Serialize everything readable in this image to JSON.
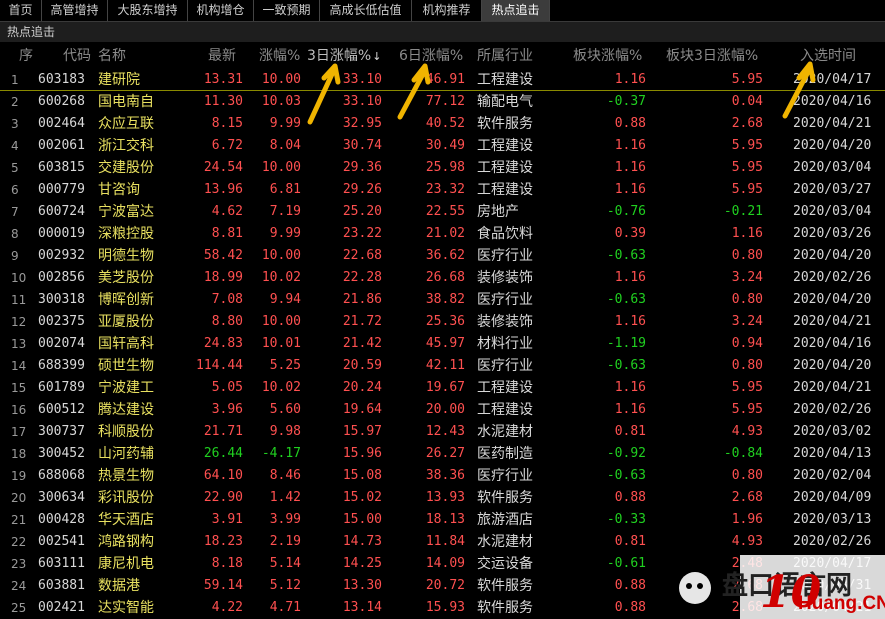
{
  "tabs": [
    {
      "label": "首页",
      "active": false
    },
    {
      "label": "高管增持",
      "active": false
    },
    {
      "label": "大股东增持",
      "active": false
    },
    {
      "label": "机构增仓",
      "active": false
    },
    {
      "label": "一致预期",
      "active": false
    },
    {
      "label": "高成长低估值",
      "active": false
    },
    {
      "label": "机构推荐",
      "active": false
    },
    {
      "label": "热点追击",
      "active": true
    }
  ],
  "subtitle": "热点追击",
  "columns": {
    "idx": "序",
    "code": "代码",
    "name": "名称",
    "price": "最新",
    "chg": "涨幅%",
    "chg3": "3日涨幅%",
    "chg6": "6日涨幅%",
    "industry": "所属行业",
    "sector_chg": "板块涨幅%",
    "sector_chg3": "板块3日涨幅%",
    "date": "入选时间",
    "sort_arrow": "↓"
  },
  "rows": [
    {
      "idx": "1",
      "code": "603183",
      "name": "建研院",
      "price": "13.31",
      "chg": "10.00",
      "chg3": "33.10",
      "chg6": "46.91",
      "industry": "工程建设",
      "sector_chg": "1.16",
      "sector_chg3": "5.95",
      "date": "2020/04/17"
    },
    {
      "idx": "2",
      "code": "600268",
      "name": "国电南自",
      "price": "11.30",
      "chg": "10.03",
      "chg3": "33.10",
      "chg6": "77.12",
      "industry": "输配电气",
      "sector_chg": "-0.37",
      "sector_chg3": "0.04",
      "date": "2020/04/16"
    },
    {
      "idx": "3",
      "code": "002464",
      "name": "众应互联",
      "price": "8.15",
      "chg": "9.99",
      "chg3": "32.95",
      "chg6": "40.52",
      "industry": "软件服务",
      "sector_chg": "0.88",
      "sector_chg3": "2.68",
      "date": "2020/04/21"
    },
    {
      "idx": "4",
      "code": "002061",
      "name": "浙江交科",
      "price": "6.72",
      "chg": "8.04",
      "chg3": "30.74",
      "chg6": "30.49",
      "industry": "工程建设",
      "sector_chg": "1.16",
      "sector_chg3": "5.95",
      "date": "2020/04/20"
    },
    {
      "idx": "5",
      "code": "603815",
      "name": "交建股份",
      "price": "24.54",
      "chg": "10.00",
      "chg3": "29.36",
      "chg6": "25.98",
      "industry": "工程建设",
      "sector_chg": "1.16",
      "sector_chg3": "5.95",
      "date": "2020/03/04"
    },
    {
      "idx": "6",
      "code": "000779",
      "name": "甘咨询",
      "price": "13.96",
      "chg": "6.81",
      "chg3": "29.26",
      "chg6": "23.32",
      "industry": "工程建设",
      "sector_chg": "1.16",
      "sector_chg3": "5.95",
      "date": "2020/03/27"
    },
    {
      "idx": "7",
      "code": "600724",
      "name": "宁波富达",
      "price": "4.62",
      "chg": "7.19",
      "chg3": "25.20",
      "chg6": "22.55",
      "industry": "房地产",
      "sector_chg": "-0.76",
      "sector_chg3": "-0.21",
      "date": "2020/03/04"
    },
    {
      "idx": "8",
      "code": "000019",
      "name": "深粮控股",
      "price": "8.81",
      "chg": "9.99",
      "chg3": "23.22",
      "chg6": "21.02",
      "industry": "食品饮料",
      "sector_chg": "0.39",
      "sector_chg3": "1.16",
      "date": "2020/03/26"
    },
    {
      "idx": "9",
      "code": "002932",
      "name": "明德生物",
      "price": "58.42",
      "chg": "10.00",
      "chg3": "22.68",
      "chg6": "36.62",
      "industry": "医疗行业",
      "sector_chg": "-0.63",
      "sector_chg3": "0.80",
      "date": "2020/04/20"
    },
    {
      "idx": "10",
      "code": "002856",
      "name": "美芝股份",
      "price": "18.99",
      "chg": "10.02",
      "chg3": "22.28",
      "chg6": "26.68",
      "industry": "装修装饰",
      "sector_chg": "1.16",
      "sector_chg3": "3.24",
      "date": "2020/02/26"
    },
    {
      "idx": "11",
      "code": "300318",
      "name": "博晖创新",
      "price": "7.08",
      "chg": "9.94",
      "chg3": "21.86",
      "chg6": "38.82",
      "industry": "医疗行业",
      "sector_chg": "-0.63",
      "sector_chg3": "0.80",
      "date": "2020/04/20"
    },
    {
      "idx": "12",
      "code": "002375",
      "name": "亚厦股份",
      "price": "8.80",
      "chg": "10.00",
      "chg3": "21.72",
      "chg6": "25.36",
      "industry": "装修装饰",
      "sector_chg": "1.16",
      "sector_chg3": "3.24",
      "date": "2020/04/21"
    },
    {
      "idx": "13",
      "code": "002074",
      "name": "国轩高科",
      "price": "24.83",
      "chg": "10.01",
      "chg3": "21.42",
      "chg6": "45.97",
      "industry": "材料行业",
      "sector_chg": "-1.19",
      "sector_chg3": "0.94",
      "date": "2020/04/16"
    },
    {
      "idx": "14",
      "code": "688399",
      "name": "硕世生物",
      "price": "114.44",
      "chg": "5.25",
      "chg3": "20.59",
      "chg6": "42.11",
      "industry": "医疗行业",
      "sector_chg": "-0.63",
      "sector_chg3": "0.80",
      "date": "2020/04/20"
    },
    {
      "idx": "15",
      "code": "601789",
      "name": "宁波建工",
      "price": "5.05",
      "chg": "10.02",
      "chg3": "20.24",
      "chg6": "19.67",
      "industry": "工程建设",
      "sector_chg": "1.16",
      "sector_chg3": "5.95",
      "date": "2020/04/21"
    },
    {
      "idx": "16",
      "code": "600512",
      "name": "腾达建设",
      "price": "3.96",
      "chg": "5.60",
      "chg3": "19.64",
      "chg6": "20.00",
      "industry": "工程建设",
      "sector_chg": "1.16",
      "sector_chg3": "5.95",
      "date": "2020/02/26"
    },
    {
      "idx": "17",
      "code": "300737",
      "name": "科顺股份",
      "price": "21.71",
      "chg": "9.98",
      "chg3": "15.97",
      "chg6": "12.43",
      "industry": "水泥建材",
      "sector_chg": "0.81",
      "sector_chg3": "4.93",
      "date": "2020/03/02"
    },
    {
      "idx": "18",
      "code": "300452",
      "name": "山河药辅",
      "price": "26.44",
      "chg": "-4.17",
      "chg3": "15.96",
      "chg6": "26.27",
      "industry": "医药制造",
      "sector_chg": "-0.92",
      "sector_chg3": "-0.84",
      "date": "2020/04/13"
    },
    {
      "idx": "19",
      "code": "688068",
      "name": "热景生物",
      "price": "64.10",
      "chg": "8.46",
      "chg3": "15.08",
      "chg6": "38.36",
      "industry": "医疗行业",
      "sector_chg": "-0.63",
      "sector_chg3": "0.80",
      "date": "2020/02/04"
    },
    {
      "idx": "20",
      "code": "300634",
      "name": "彩讯股份",
      "price": "22.90",
      "chg": "1.42",
      "chg3": "15.02",
      "chg6": "13.93",
      "industry": "软件服务",
      "sector_chg": "0.88",
      "sector_chg3": "2.68",
      "date": "2020/04/09"
    },
    {
      "idx": "21",
      "code": "000428",
      "name": "华天酒店",
      "price": "3.91",
      "chg": "3.99",
      "chg3": "15.00",
      "chg6": "18.13",
      "industry": "旅游酒店",
      "sector_chg": "-0.33",
      "sector_chg3": "1.96",
      "date": "2020/03/13"
    },
    {
      "idx": "22",
      "code": "002541",
      "name": "鸿路钢构",
      "price": "18.23",
      "chg": "2.19",
      "chg3": "14.73",
      "chg6": "11.84",
      "industry": "水泥建材",
      "sector_chg": "0.81",
      "sector_chg3": "4.93",
      "date": "2020/02/26"
    },
    {
      "idx": "23",
      "code": "603111",
      "name": "康尼机电",
      "price": "8.18",
      "chg": "5.14",
      "chg3": "14.25",
      "chg6": "14.09",
      "industry": "交运设备",
      "sector_chg": "-0.61",
      "sector_chg3": "2.48",
      "date": "2020/04/17"
    },
    {
      "idx": "24",
      "code": "603881",
      "name": "数据港",
      "price": "59.14",
      "chg": "5.12",
      "chg3": "13.30",
      "chg6": "20.72",
      "industry": "软件服务",
      "sector_chg": "0.88",
      "sector_chg3": "2.68",
      "date": "2020/03/31"
    },
    {
      "idx": "25",
      "code": "002421",
      "name": "达实智能",
      "price": "4.22",
      "chg": "4.71",
      "chg3": "13.14",
      "chg6": "15.93",
      "industry": "软件服务",
      "sector_chg": "0.88",
      "sector_chg3": "2.68",
      "date": "2020/04/21"
    }
  ],
  "watermark": {
    "text": "盘口语言网",
    "number": "10",
    "domain": "Huang.CN"
  },
  "colors": {
    "up": "#ff5050",
    "down": "#20d020",
    "name": "#e8e060",
    "annotation": "#f0b400"
  }
}
